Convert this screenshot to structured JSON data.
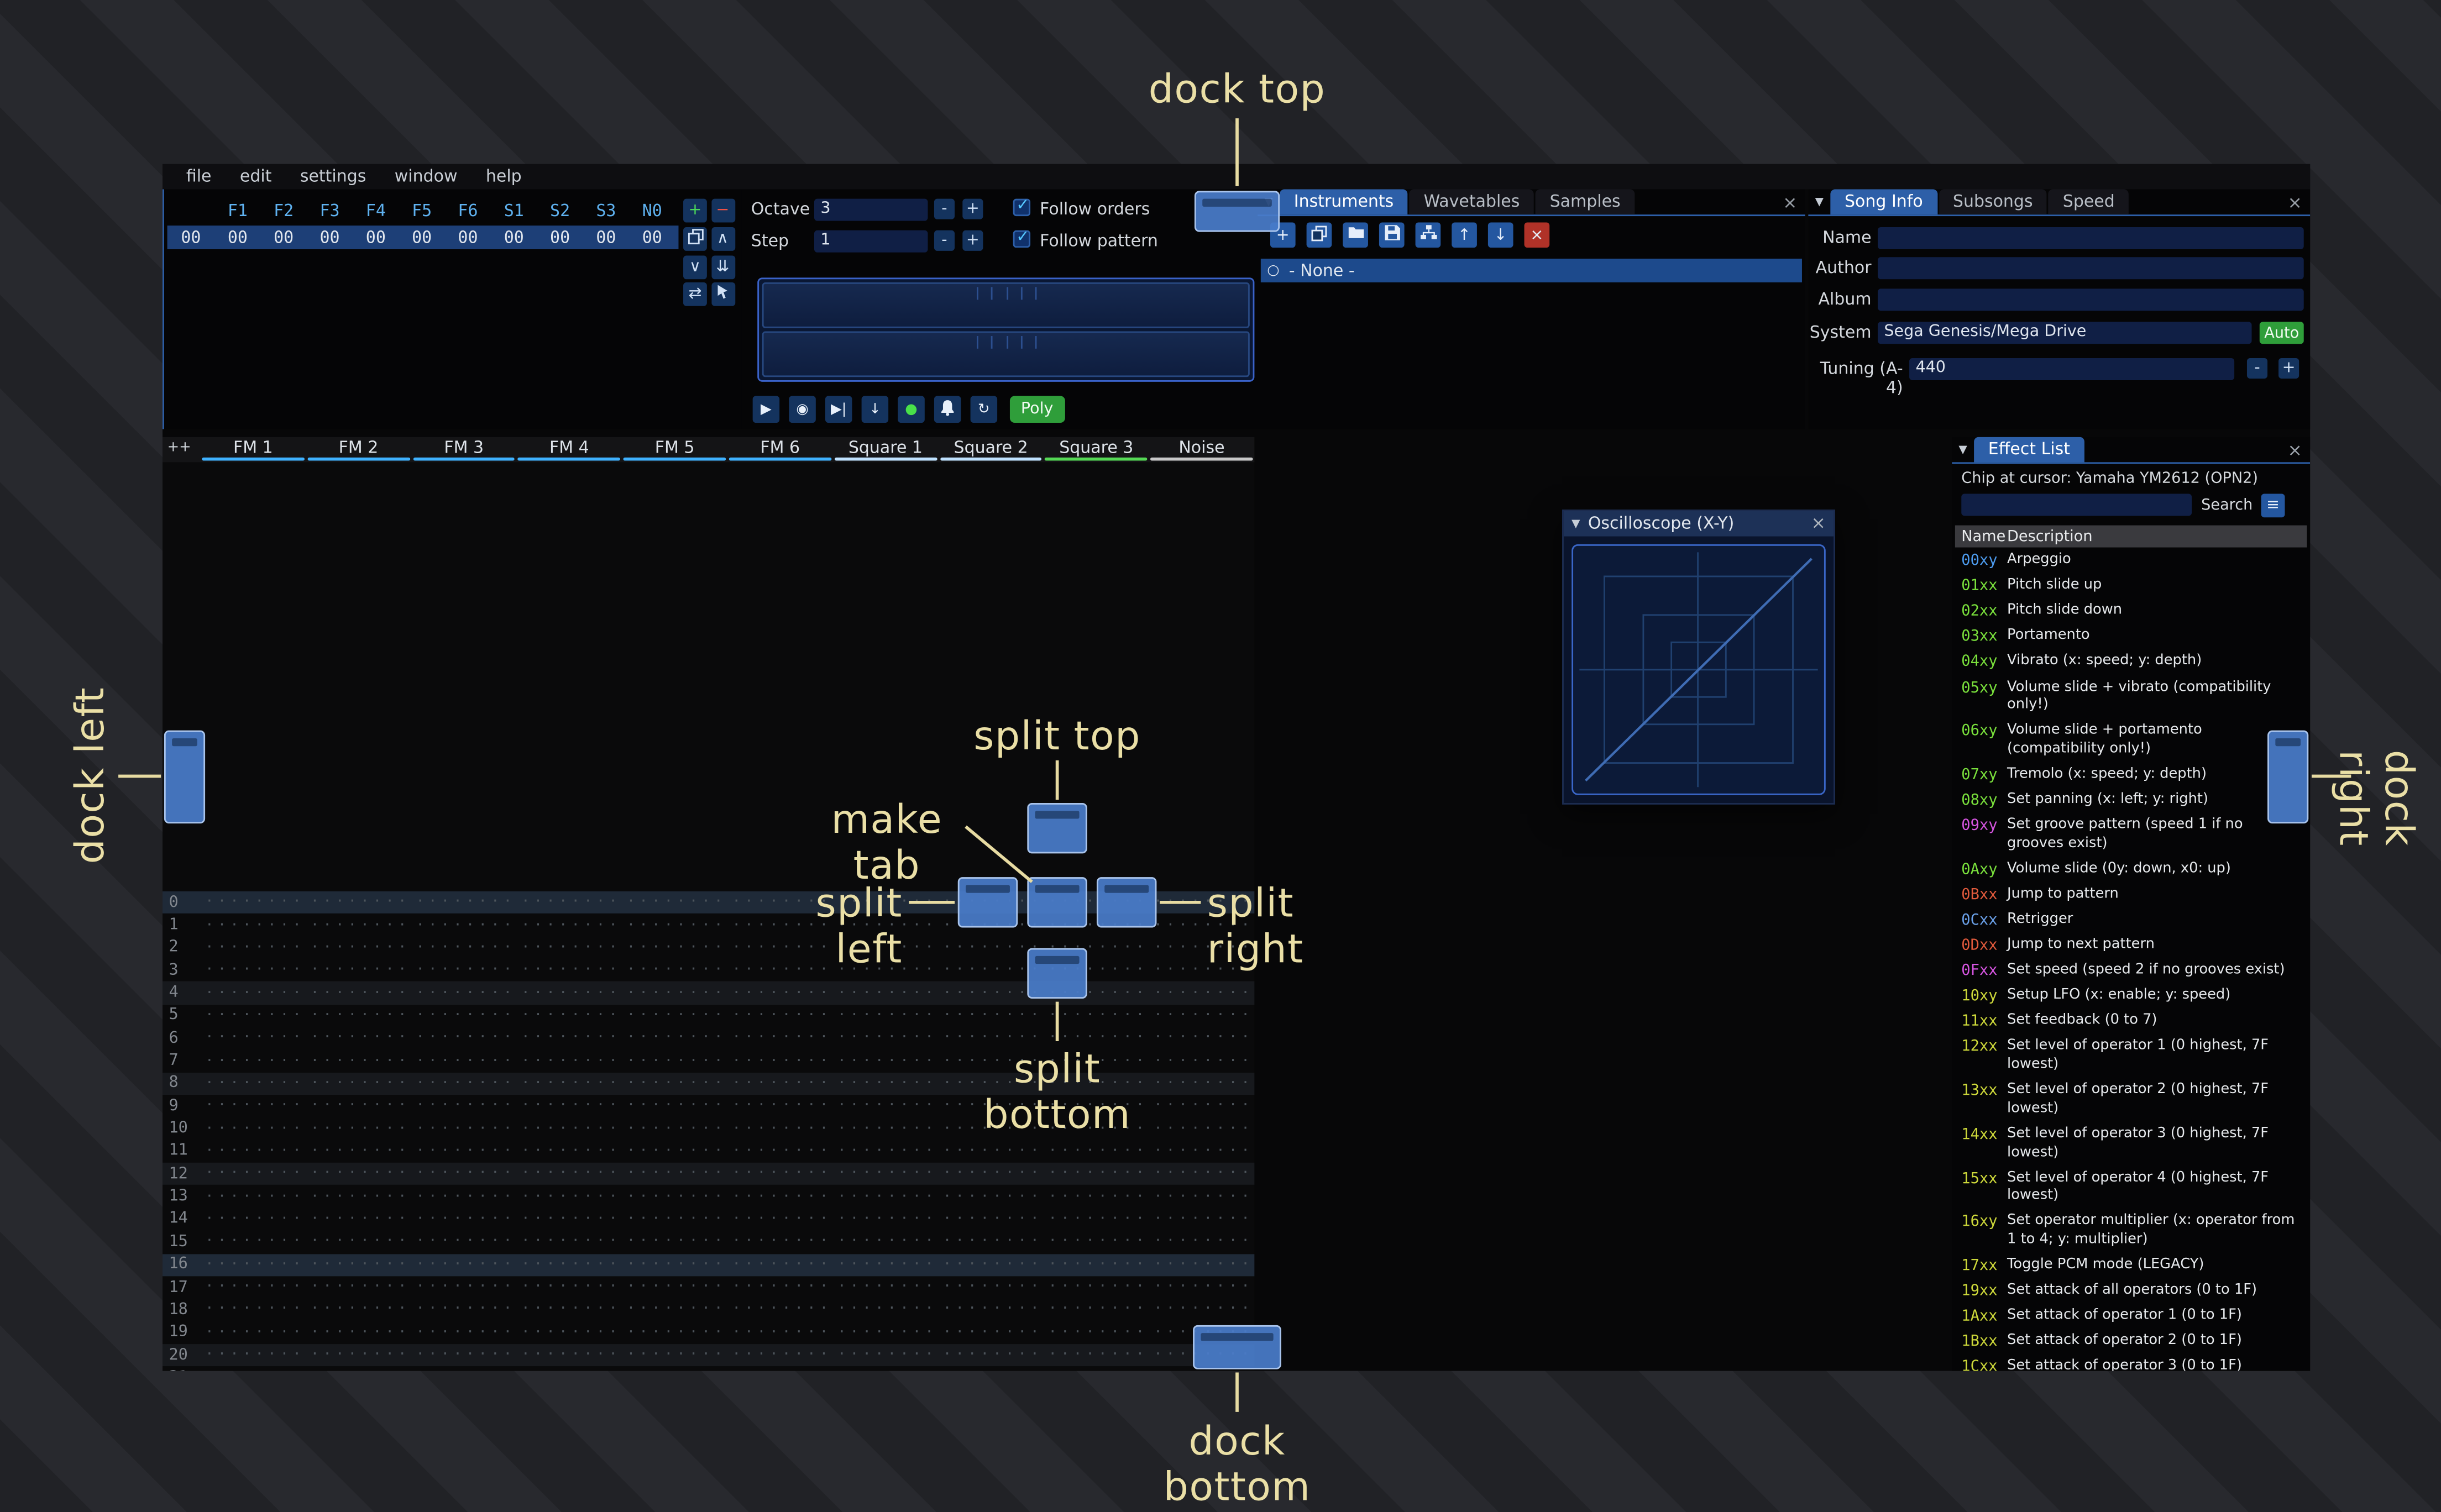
{
  "menu_bar": {
    "items": [
      "file",
      "edit",
      "settings",
      "window",
      "help"
    ]
  },
  "orders": {
    "row_index": "00",
    "channel_headers": [
      "F1",
      "F2",
      "F3",
      "F4",
      "F5",
      "F6",
      "S1",
      "S2",
      "S3",
      "N0"
    ],
    "row_cells": [
      "00",
      "00",
      "00",
      "00",
      "00",
      "00",
      "00",
      "00",
      "00",
      "00"
    ],
    "buttons": [
      {
        "name": "add-order-button",
        "icon": "plus",
        "color": "#4bd85a"
      },
      {
        "name": "remove-order-button",
        "icon": "minus",
        "color": "#ee5246"
      },
      {
        "name": "duplicate-order-button",
        "icon": "duplicate",
        "color": "#d2e2f6"
      },
      {
        "name": "move-order-up-button",
        "icon": "chevron-up",
        "color": "#d2e2f6"
      },
      {
        "name": "move-order-down-button",
        "icon": "chevron-down",
        "color": "#d2e2f6"
      },
      {
        "name": "deep-clone-order-button",
        "icon": "double-down",
        "color": "#d2e2f6"
      },
      {
        "name": "change-all-orders-button",
        "icon": "swap",
        "color": "#d2e2f6"
      },
      {
        "name": "order-edit-mode-button",
        "icon": "pointer",
        "color": "#d2e2f6"
      }
    ]
  },
  "controls": {
    "octave_label": "Octave",
    "octave_value": "3",
    "step_label": "Step",
    "step_value": "1",
    "minus": "-",
    "plus": "+",
    "follow_orders": "Follow orders",
    "follow_pattern": "Follow pattern",
    "poly": "Poly",
    "transport": [
      {
        "name": "play-button",
        "icon": "play",
        "color": "#e8f0fa"
      },
      {
        "name": "play-from-beginning-button",
        "icon": "play-circle",
        "color": "#e8f0fa"
      },
      {
        "name": "play-one-row-button",
        "icon": "play-row",
        "color": "#e8f0fa"
      },
      {
        "name": "step-one-row-button",
        "icon": "arrow-down",
        "color": "#e8f0fa"
      },
      {
        "name": "record-button",
        "icon": "record",
        "color": "#49e049"
      },
      {
        "name": "metronome-button",
        "icon": "bell",
        "color": "#e8f0fa"
      },
      {
        "name": "repeat-pattern-button",
        "icon": "repeat",
        "color": "#e8f0fa"
      }
    ]
  },
  "instruments": {
    "tabs": [
      {
        "label": "Instruments",
        "active": true
      },
      {
        "label": "Wavetables",
        "active": false
      },
      {
        "label": "Samples",
        "active": false
      }
    ],
    "toolbar": [
      {
        "name": "add-instrument-button",
        "icon": "plus",
        "style": "blue"
      },
      {
        "name": "duplicate-instrument-button",
        "icon": "duplicate",
        "style": "blue"
      },
      {
        "name": "open-instrument-button",
        "icon": "folder",
        "style": "blue"
      },
      {
        "name": "save-instrument-button",
        "icon": "floppy",
        "style": "blue"
      },
      {
        "name": "instrument-folders-button",
        "icon": "sitemap",
        "style": "blue"
      },
      {
        "name": "move-instrument-up-button",
        "icon": "arrow-up",
        "style": "blue"
      },
      {
        "name": "move-instrument-down-button",
        "icon": "arrow-down",
        "style": "blue"
      },
      {
        "name": "delete-instrument-button",
        "icon": "close",
        "style": "red"
      }
    ],
    "items": [
      {
        "label": "- None -",
        "selected": true
      }
    ]
  },
  "song_info": {
    "tabs": [
      {
        "label": "Song Info",
        "active": true
      },
      {
        "label": "Subsongs",
        "active": false
      },
      {
        "label": "Speed",
        "active": false
      }
    ],
    "text_fields": [
      {
        "name": "name",
        "label": "Name",
        "value": ""
      },
      {
        "name": "author",
        "label": "Author",
        "value": ""
      },
      {
        "name": "album",
        "label": "Album",
        "value": ""
      }
    ],
    "system_label": "System",
    "system_value": "Sega Genesis/Mega Drive",
    "auto_button": "Auto",
    "tuning_label": "Tuning (A-4)",
    "tuning_value": "440"
  },
  "pattern": {
    "corner": "++",
    "channels": [
      {
        "name": "FM 1",
        "color": "#3fb2ff"
      },
      {
        "name": "FM 2",
        "color": "#3fb2ff"
      },
      {
        "name": "FM 3",
        "color": "#3fb2ff"
      },
      {
        "name": "FM 4",
        "color": "#3fb2ff"
      },
      {
        "name": "FM 5",
        "color": "#3fb2ff"
      },
      {
        "name": "FM 6",
        "color": "#3fb2ff"
      },
      {
        "name": "Square 1",
        "color": "#bfe2ff"
      },
      {
        "name": "Square 2",
        "color": "#bfe2ff"
      },
      {
        "name": "Square 3",
        "color": "#55d855"
      },
      {
        "name": "Noise",
        "color": "#c8c8c8"
      }
    ],
    "visible_rows": 22,
    "hilight_a": 4,
    "hilight_b": 16
  },
  "oscilloscope": {
    "title": "Oscilloscope (X-Y)"
  },
  "effect_list": {
    "tab_label": "Effect List",
    "chip_label": "Chip at cursor: Yamaha YM2612 (OPN2)",
    "search_label": "Search",
    "columns": {
      "name": "Name",
      "description": "Description"
    },
    "effects": [
      {
        "code": "00xy",
        "color": "#4d9bee",
        "desc": "Arpeggio"
      },
      {
        "code": "01xx",
        "color": "#7ae03c",
        "desc": "Pitch slide up"
      },
      {
        "code": "02xx",
        "color": "#7ae03c",
        "desc": "Pitch slide down"
      },
      {
        "code": "03xx",
        "color": "#7ae03c",
        "desc": "Portamento"
      },
      {
        "code": "04xy",
        "color": "#7ae03c",
        "desc": "Vibrato (x: speed; y: depth)"
      },
      {
        "code": "05xy",
        "color": "#7ae03c",
        "desc": "Volume slide + vibrato (compatibility only!)"
      },
      {
        "code": "06xy",
        "color": "#7ae03c",
        "desc": "Volume slide + portamento (compatibility only!)"
      },
      {
        "code": "07xy",
        "color": "#7ae03c",
        "desc": "Tremolo (x: speed; y: depth)"
      },
      {
        "code": "08xy",
        "color": "#7ae03c",
        "desc": "Set panning (x: left; y: right)"
      },
      {
        "code": "09xy",
        "color": "#d655e0",
        "desc": "Set groove pattern (speed 1 if no grooves exist)"
      },
      {
        "code": "0Axy",
        "color": "#7ae03c",
        "desc": "Volume slide (0y: down, x0: up)"
      },
      {
        "code": "0Bxx",
        "color": "#e05a3c",
        "desc": "Jump to pattern"
      },
      {
        "code": "0Cxx",
        "color": "#6aa0e8",
        "desc": "Retrigger"
      },
      {
        "code": "0Dxx",
        "color": "#e05a3c",
        "desc": "Jump to next pattern"
      },
      {
        "code": "0Fxx",
        "color": "#d655e0",
        "desc": "Set speed (speed 2 if no grooves exist)"
      },
      {
        "code": "10xy",
        "color": "#cdd83a",
        "desc": "Setup LFO (x: enable; y: speed)"
      },
      {
        "code": "11xx",
        "color": "#cdd83a",
        "desc": "Set feedback (0 to 7)"
      },
      {
        "code": "12xx",
        "color": "#cdd83a",
        "desc": "Set level of operator 1 (0 highest, 7F lowest)"
      },
      {
        "code": "13xx",
        "color": "#cdd83a",
        "desc": "Set level of operator 2 (0 highest, 7F lowest)"
      },
      {
        "code": "14xx",
        "color": "#cdd83a",
        "desc": "Set level of operator 3 (0 highest, 7F lowest)"
      },
      {
        "code": "15xx",
        "color": "#cdd83a",
        "desc": "Set level of operator 4 (0 highest, 7F lowest)"
      },
      {
        "code": "16xy",
        "color": "#cdd83a",
        "desc": "Set operator multiplier (x: operator from 1 to 4; y: multiplier)"
      },
      {
        "code": "17xx",
        "color": "#cdd83a",
        "desc": "Toggle PCM mode (LEGACY)"
      },
      {
        "code": "19xx",
        "color": "#cdd83a",
        "desc": "Set attack of all operators (0 to 1F)"
      },
      {
        "code": "1Axx",
        "color": "#cdd83a",
        "desc": "Set attack of operator 1 (0 to 1F)"
      },
      {
        "code": "1Bxx",
        "color": "#cdd83a",
        "desc": "Set attack of operator 2 (0 to 1F)"
      },
      {
        "code": "1Cxx",
        "color": "#cdd83a",
        "desc": "Set attack of operator 3 (0 to 1F)"
      }
    ]
  },
  "dock_overlay": {
    "dock_top": "dock top",
    "dock_bottom": "dock bottom",
    "dock_left": "dock left",
    "dock_right": "dock right",
    "split_top": "split top",
    "split_bottom": "split bottom",
    "split_left": "split left",
    "split_right": "split right",
    "make_tab": "make tab"
  }
}
